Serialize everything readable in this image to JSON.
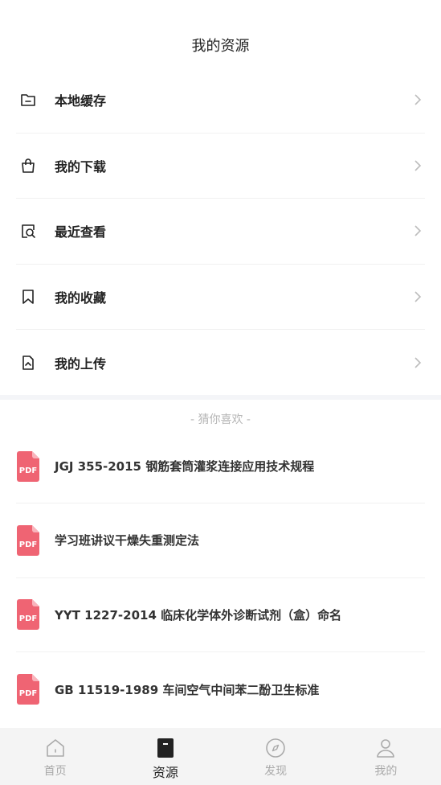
{
  "header": {
    "title": "我的资源"
  },
  "menu": {
    "items": [
      {
        "label": "本地缓存",
        "icon": "folder-icon"
      },
      {
        "label": "我的下载",
        "icon": "shopping-bag-icon"
      },
      {
        "label": "最近查看",
        "icon": "recent-search-icon"
      },
      {
        "label": "我的收藏",
        "icon": "bookmark-icon"
      },
      {
        "label": "我的上传",
        "icon": "upload-file-icon"
      }
    ]
  },
  "recommend": {
    "title": "- 猜你喜欢 -",
    "pdf_badge": "PDF",
    "pdf_color": "#ef6473",
    "items": [
      {
        "title": "JGJ 355-2015 钢筋套筒灌浆连接应用技术规程"
      },
      {
        "title": "学习班讲议干燥失重测定法"
      },
      {
        "title": "YYT 1227-2014 临床化学体外诊断试剂（盒）命名"
      },
      {
        "title": "GB 11519-1989 车间空气中间苯二酚卫生标准"
      }
    ]
  },
  "tabbar": {
    "tabs": [
      {
        "label": "首页",
        "icon": "home-icon",
        "active": false
      },
      {
        "label": "资源",
        "icon": "document-icon",
        "active": true
      },
      {
        "label": "发现",
        "icon": "compass-icon",
        "active": false
      },
      {
        "label": "我的",
        "icon": "user-icon",
        "active": false
      }
    ]
  }
}
